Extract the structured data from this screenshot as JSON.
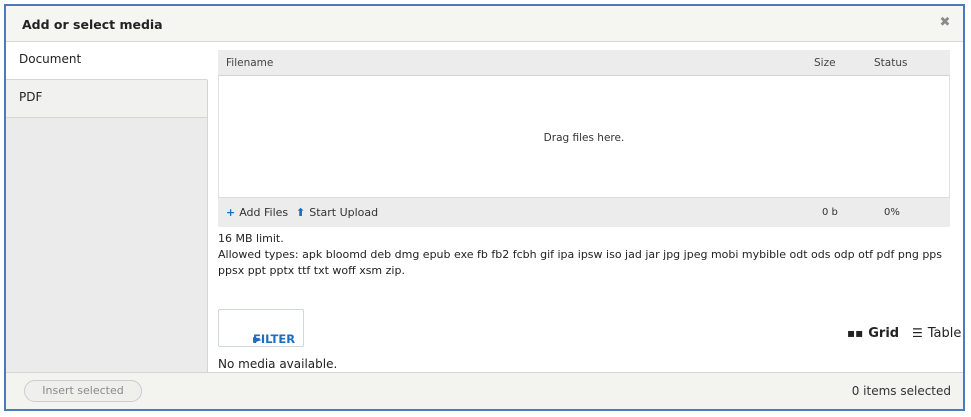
{
  "dialog": {
    "title": "Add or select media",
    "close_icon": "close-icon",
    "close_glyph": "✖"
  },
  "sidebar": {
    "tabs": [
      {
        "label": "Document",
        "active": true
      },
      {
        "label": "PDF",
        "active": false
      }
    ]
  },
  "uploader": {
    "columns": {
      "filename": "Filename",
      "size": "Size",
      "status": "Status"
    },
    "drop_text": "Drag files here.",
    "add_files_label": "Add Files",
    "add_files_icon": "plus-icon",
    "add_files_glyph": "+",
    "start_upload_label": "Start Upload",
    "start_upload_icon": "upload-arrow-icon",
    "start_upload_glyph": "⬆",
    "total_size": "0 b",
    "total_percent": "0%"
  },
  "limits": {
    "size_limit": "16 MB limit.",
    "allowed_types": "Allowed types: apk bloomd deb dmg epub exe fb fb2 fcbh gif ipa ipsw iso jad jar jpg jpeg mobi mybible odt ods odp otf pdf png pps ppsx ppt pptx ttf txt woff xsm zip."
  },
  "filter": {
    "label": "FILTER",
    "icon": "triangle-right-icon",
    "glyph": "►"
  },
  "view": {
    "grid_label": "Grid",
    "grid_icon": "grid-icon",
    "grid_glyph": "▪▪",
    "table_label": "Table",
    "table_icon": "list-icon",
    "table_glyph": "☰"
  },
  "empty_message": "No media available.",
  "footer": {
    "insert_label": "Insert selected",
    "count_text": "0 items selected"
  },
  "colors": {
    "accent": "#1a6fc0",
    "frame": "#4a7ac0"
  }
}
